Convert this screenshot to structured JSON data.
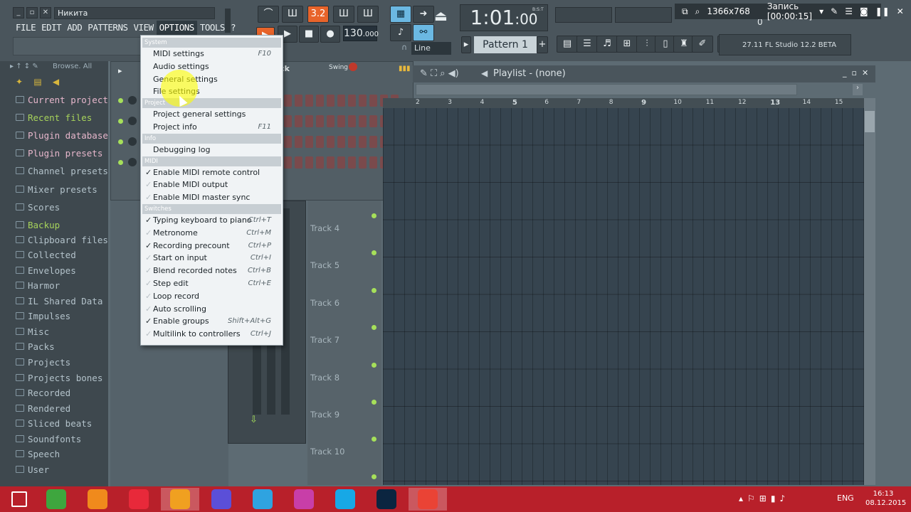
{
  "window": {
    "title_field": "Никита"
  },
  "menubar": [
    "FILE",
    "EDIT",
    "ADD",
    "PATTERNS",
    "VIEW",
    "OPTIONS",
    "TOOLS",
    "?"
  ],
  "transport": {
    "tempo": "130",
    "tempo_dec": ".000",
    "time": "1:01",
    "time_frac": ":00",
    "bst": "B:S:T",
    "pattern": "Pattern 1",
    "snap": "Line",
    "pitch_display": "3.2"
  },
  "hint_panel": {
    "text": "27.11  FL Studio 12.2 BETA"
  },
  "recorder": {
    "resolution": "1366x768",
    "status": "Запись [00:00:15]",
    "counter": "0"
  },
  "browser": {
    "header": "Browse.  All",
    "items": [
      {
        "label": "Current project",
        "style": "pink"
      },
      {
        "label": "Recent files",
        "style": "green"
      },
      {
        "label": "Plugin database",
        "style": "pink"
      },
      {
        "label": "Plugin presets",
        "style": "pink"
      },
      {
        "label": "Channel presets",
        "style": "normal"
      },
      {
        "label": "Mixer presets",
        "style": "normal"
      },
      {
        "label": "Scores",
        "style": "normal"
      },
      {
        "label": "Backup",
        "style": "green"
      },
      {
        "label": "Clipboard files",
        "style": "normal"
      },
      {
        "label": "Collected",
        "style": "normal"
      },
      {
        "label": "Envelopes",
        "style": "normal"
      },
      {
        "label": "Harmor",
        "style": "normal"
      },
      {
        "label": "IL Shared Data",
        "style": "normal"
      },
      {
        "label": "Impulses",
        "style": "normal"
      },
      {
        "label": "Misc",
        "style": "normal"
      },
      {
        "label": "Packs",
        "style": "normal"
      },
      {
        "label": "Projects",
        "style": "normal"
      },
      {
        "label": "Projects bones",
        "style": "normal"
      },
      {
        "label": "Recorded",
        "style": "normal"
      },
      {
        "label": "Rendered",
        "style": "normal"
      },
      {
        "label": "Sliced beats",
        "style": "normal"
      },
      {
        "label": "Soundfonts",
        "style": "normal"
      },
      {
        "label": "Speech",
        "style": "normal"
      },
      {
        "label": "User",
        "style": "normal"
      }
    ]
  },
  "channel_rack": {
    "title_fragment": "ck",
    "swing_label": "Swing"
  },
  "playlist": {
    "title": "Playlist - (none)",
    "ruler": [
      "2",
      "3",
      "4",
      "5",
      "6",
      "7",
      "8",
      "9",
      "10",
      "11",
      "12",
      "13",
      "14",
      "15"
    ],
    "tracks": [
      "Track 4",
      "Track 5",
      "Track 6",
      "Track 7",
      "Track 8",
      "Track 9",
      "Track 10"
    ]
  },
  "options_menu": {
    "sections": {
      "system": "System",
      "project": "Project",
      "info": "Info",
      "midi": "MIDI",
      "switches": "Switches"
    },
    "system_items": [
      {
        "label": "MIDI settings",
        "shortcut": "F10"
      },
      {
        "label": "Audio settings",
        "shortcut": ""
      },
      {
        "label": "General settings",
        "shortcut": ""
      },
      {
        "label": "File settings",
        "shortcut": ""
      }
    ],
    "project_items": [
      {
        "label": "Project general settings",
        "shortcut": ""
      },
      {
        "label": "Project info",
        "shortcut": "F11"
      }
    ],
    "info_items": [
      {
        "label": "Debugging log",
        "shortcut": ""
      }
    ],
    "midi_items": [
      {
        "label": "Enable MIDI remote control",
        "shortcut": "",
        "checked": true
      },
      {
        "label": "Enable MIDI output",
        "shortcut": "",
        "checked": false
      },
      {
        "label": "Enable MIDI master sync",
        "shortcut": "",
        "checked": false
      }
    ],
    "switch_items": [
      {
        "label": "Typing keyboard to piano",
        "shortcut": "Ctrl+T",
        "checked": true
      },
      {
        "label": "Metronome",
        "shortcut": "Ctrl+M",
        "checked": false
      },
      {
        "label": "Recording precount",
        "shortcut": "Ctrl+P",
        "checked": true
      },
      {
        "label": "Start on input",
        "shortcut": "Ctrl+I",
        "checked": false
      },
      {
        "label": "Blend recorded notes",
        "shortcut": "Ctrl+B",
        "checked": false
      },
      {
        "label": "Step edit",
        "shortcut": "Ctrl+E",
        "checked": false
      },
      {
        "label": "Loop record",
        "shortcut": "",
        "checked": false
      },
      {
        "label": "Auto scrolling",
        "shortcut": "",
        "checked": false
      },
      {
        "label": "Enable groups",
        "shortcut": "Shift+Alt+G",
        "checked": true
      },
      {
        "label": "Multilink to controllers",
        "shortcut": "Ctrl+J",
        "checked": false
      }
    ]
  },
  "taskbar": {
    "apps": [
      {
        "name": "windows-start",
        "color": "#ffffff"
      },
      {
        "name": "utorrent",
        "color": "#3ea63e"
      },
      {
        "name": "avast",
        "color": "#f08a1c"
      },
      {
        "name": "media-recorder",
        "color": "#e8293a"
      },
      {
        "name": "fl-studio",
        "color": "#f0a020"
      },
      {
        "name": "settings",
        "color": "#5b4fd8"
      },
      {
        "name": "media-player",
        "color": "#2fa3e0"
      },
      {
        "name": "camera",
        "color": "#c83ea8"
      },
      {
        "name": "skype",
        "color": "#17a8e6"
      },
      {
        "name": "photoshop",
        "color": "#0b2540"
      },
      {
        "name": "chrome",
        "color": "#ea4335"
      }
    ],
    "lang": "ENG",
    "time": "16:13",
    "date": "08.12.2015"
  }
}
